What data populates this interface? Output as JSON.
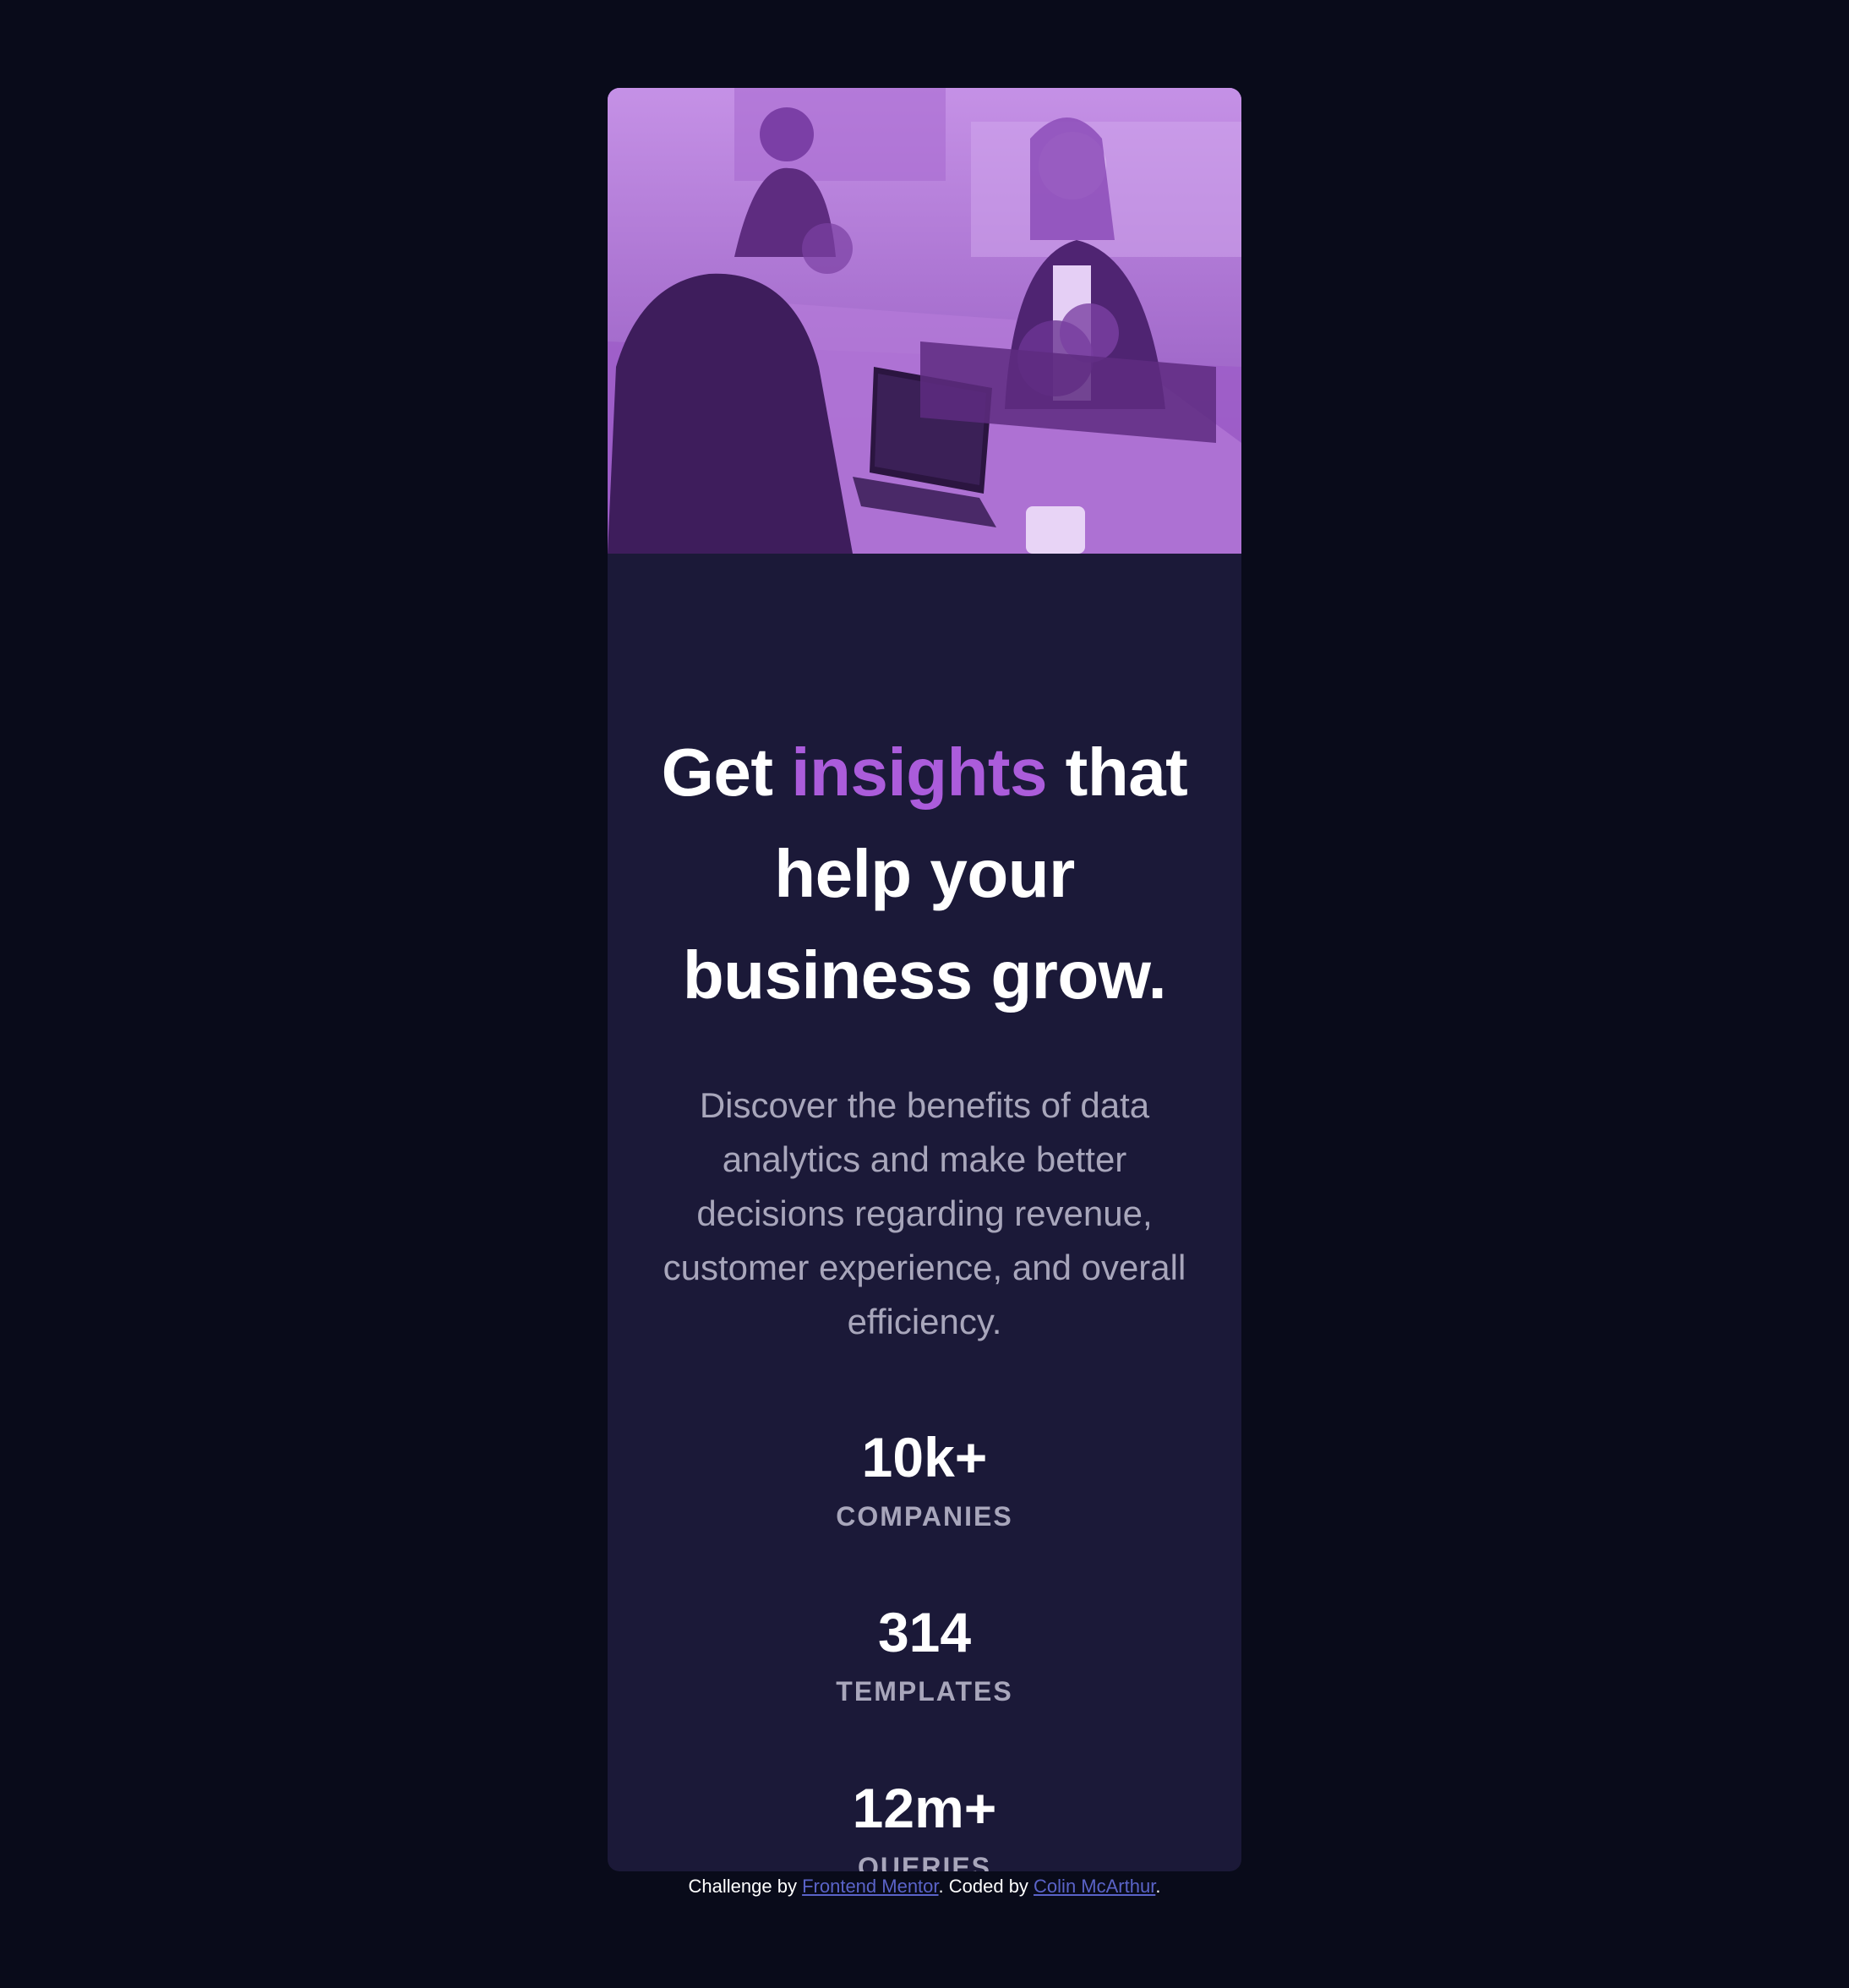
{
  "colors": {
    "page_background": "#090b1a",
    "card_background": "#1b1938",
    "accent": "#ab5cdb",
    "image_tint": "#a963d6",
    "heading": "#ffffff",
    "body_text": "#a8a6bb",
    "link": "#5a63c8"
  },
  "hero_image": {
    "icon": "team-working-photo"
  },
  "heading": {
    "part1": "Get ",
    "accent": "insights",
    "part2": " that help your business grow."
  },
  "description": "Discover the benefits of data analytics and make better decisions regarding revenue, customer experience, and overall efficiency.",
  "stats": [
    {
      "value": "10k+",
      "label": "COMPANIES"
    },
    {
      "value": "314",
      "label": "TEMPLATES"
    },
    {
      "value": "12m+",
      "label": "QUERIES"
    }
  ],
  "attribution": {
    "prefix": "Challenge by ",
    "link1": "Frontend Mentor",
    "middle": ". Coded by ",
    "link2": "Colin McArthur",
    "suffix": "."
  }
}
